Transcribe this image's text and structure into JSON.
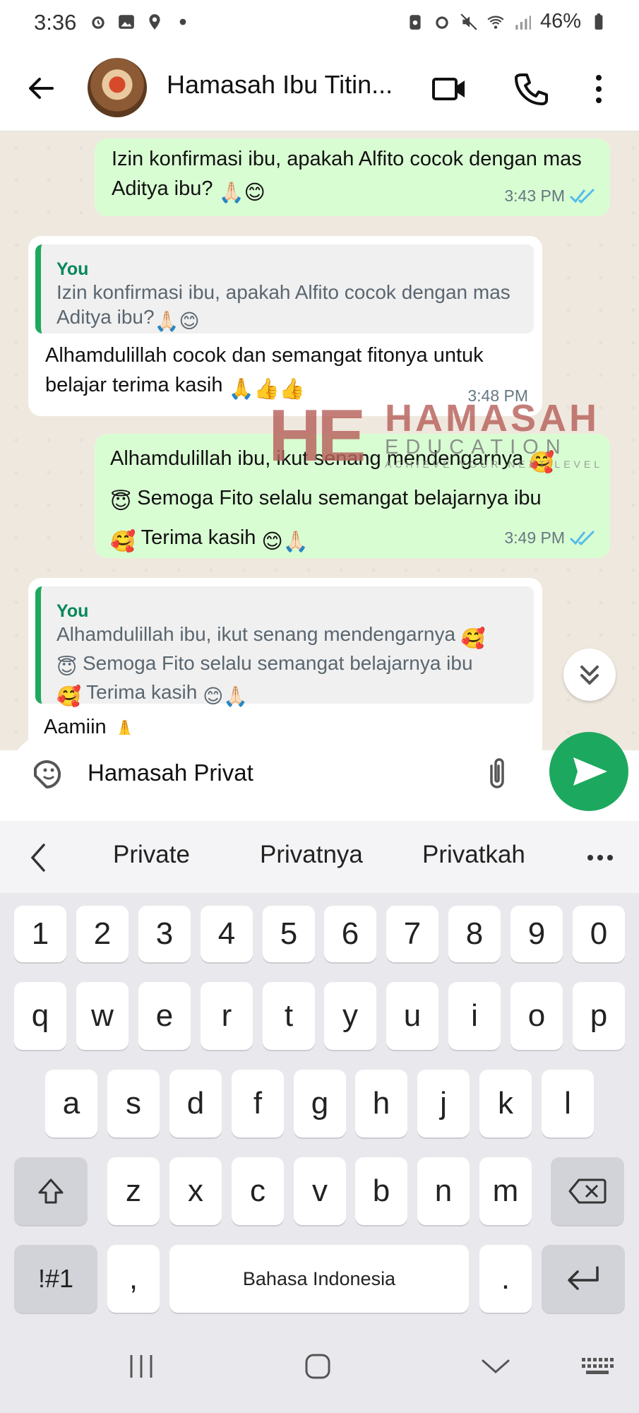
{
  "status_bar": {
    "time": "3:36",
    "battery": "46%"
  },
  "header": {
    "title": "Hamasah Ibu Titin...",
    "icons": [
      "back-arrow-icon",
      "video-call-icon",
      "phone-icon",
      "more-vert-icon"
    ]
  },
  "messages": [
    {
      "direction": "outgoing",
      "text": "Izin konfirmasi ibu, apakah Alfito cocok dengan mas Aditya ibu?",
      "emoji": "🙏🏻😊",
      "time": "3:43 PM",
      "status": "read"
    },
    {
      "direction": "incoming",
      "quote_author": "You",
      "quote_text": "Izin konfirmasi ibu, apakah Alfito cocok dengan mas Aditya ibu?",
      "quote_emoji": "🙏🏻😊",
      "text": "Alhamdulillah cocok dan semangat fitonya untuk belajar terima kasih",
      "emoji": "🙏👍👍",
      "time": "3:48 PM"
    },
    {
      "direction": "outgoing",
      "line1": "Alhamdulillah ibu, ikut senang mendengarnya",
      "line2": "Semoga Fito selalu semangat belajarnya ibu",
      "line3": "Terima kasih",
      "time": "3:49 PM",
      "status": "read"
    },
    {
      "direction": "incoming",
      "quote_author": "You",
      "quote_line1": "Alhamdulillah ibu, ikut senang mendengarnya",
      "quote_line2": "Semoga Fito selalu semangat belajarnya ibu",
      "quote_line3": "Terima kasih",
      "text": "Aamiin",
      "emoji": "🙏"
    }
  ],
  "watermark": {
    "logo": "HE",
    "name": "HAMASAH",
    "sub": "EDUCATION",
    "tagline": "ACHIEVE YOUR NEXT LEVEL"
  },
  "composer": {
    "value": "Hamasah Privat"
  },
  "suggestions": [
    "Private",
    "Privatnya",
    "Privatkah"
  ],
  "keyboard": {
    "row_numbers": [
      "1",
      "2",
      "3",
      "4",
      "5",
      "6",
      "7",
      "8",
      "9",
      "0"
    ],
    "row1": [
      "q",
      "w",
      "e",
      "r",
      "t",
      "y",
      "u",
      "i",
      "o",
      "p"
    ],
    "row2": [
      "a",
      "s",
      "d",
      "f",
      "g",
      "h",
      "j",
      "k",
      "l"
    ],
    "row3": [
      "z",
      "x",
      "c",
      "v",
      "b",
      "n",
      "m"
    ],
    "symbols_key": "!#1",
    "comma_key": ",",
    "space_label": "Bahasa Indonesia",
    "period_key": "."
  },
  "colors": {
    "accent": "#1da85f",
    "outgoing_bubble": "#d9fdd3",
    "chat_bg": "#efe8de",
    "tick_blue": "#53bdeb"
  }
}
